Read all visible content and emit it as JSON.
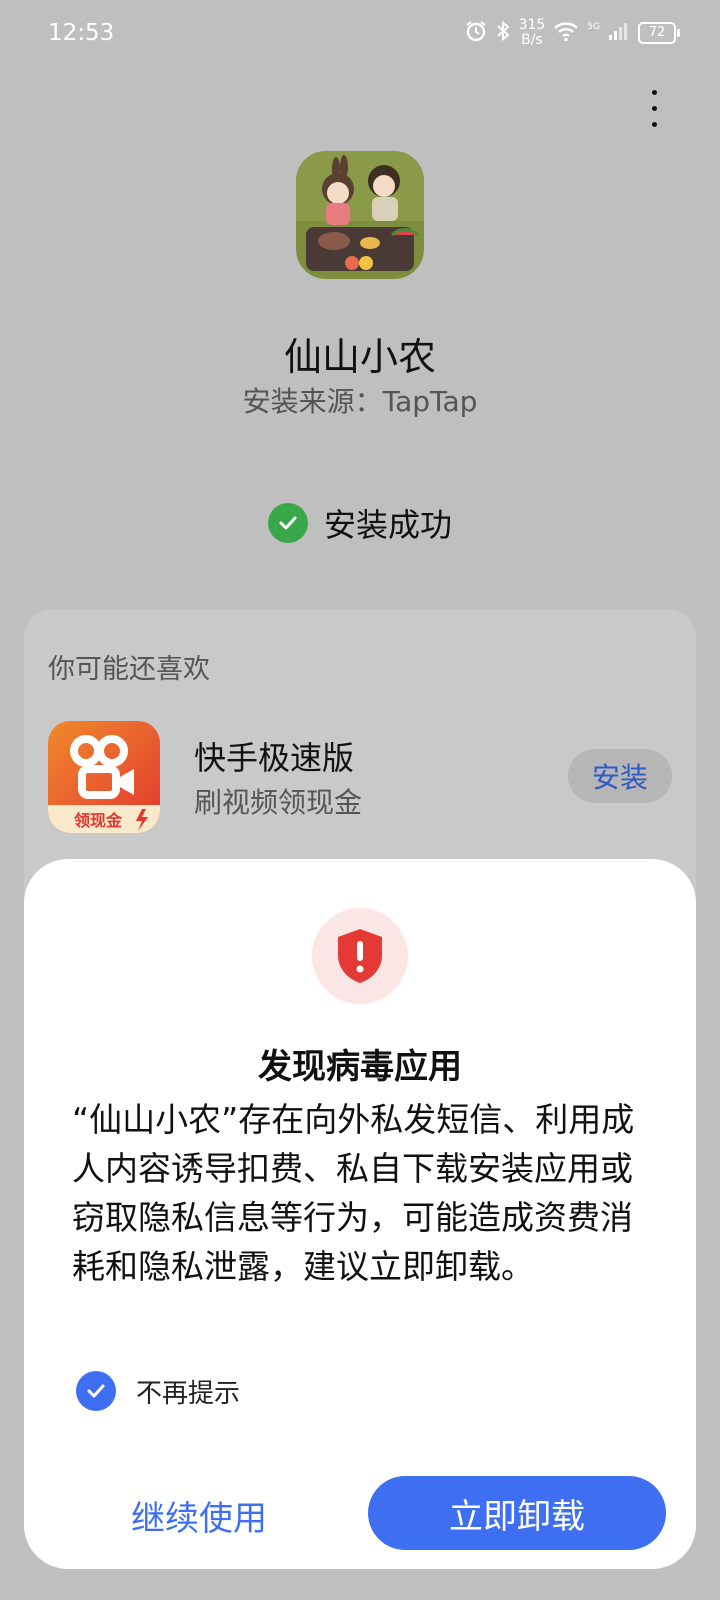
{
  "status_bar": {
    "time": "12:53",
    "net_speed_value": "315",
    "net_speed_unit": "B/s",
    "signal_label": "5G",
    "battery": "72"
  },
  "app": {
    "name": "仙山小农",
    "source": "安装来源：TapTap"
  },
  "install_status": "安装成功",
  "recommend": {
    "title": "你可能还喜欢",
    "app_name": "快手极速版",
    "app_desc": "刷视频领现金",
    "icon_badge": "领现金",
    "install_label": "安装"
  },
  "dialog": {
    "title": "发现病毒应用",
    "message": "“仙山小农”存在向外私发短信、利用成人内容诱导扣费、私自下载安装应用或窃取隐私信息等行为，可能造成资费消耗和隐私泄露，建议立即卸载。",
    "dont_remind_label": "不再提示",
    "dont_remind_checked": true,
    "continue_label": "继续使用",
    "uninstall_label": "立即卸载"
  },
  "colors": {
    "accent": "#3e6ff2",
    "success": "#3aa84a",
    "warning": "#e53935"
  }
}
